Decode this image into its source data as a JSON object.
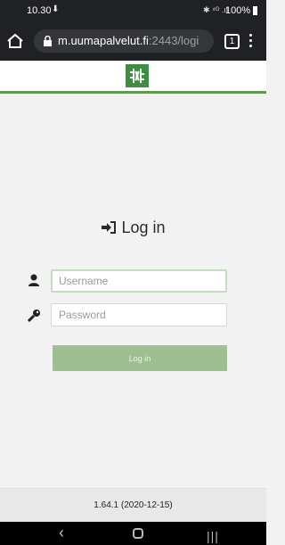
{
  "status_bar": {
    "time": "10.30",
    "download_icon": "⬇",
    "signal_text": "✱ ⁴ᴳ .ıl",
    "battery": "100%"
  },
  "browser": {
    "url_host": "m.uumapalvelut.fi",
    "url_path": ":2443/logi",
    "tab_count": "1"
  },
  "login": {
    "title": "Log in",
    "username_placeholder": "Username",
    "password_placeholder": "Password",
    "button_label": "Log in"
  },
  "footer": {
    "version": "1.64.1 (2020-12-15)"
  },
  "nav": {
    "back": "‹",
    "recent": "|||"
  },
  "colors": {
    "accent": "#5f9b4e",
    "button": "#9ebf92"
  }
}
